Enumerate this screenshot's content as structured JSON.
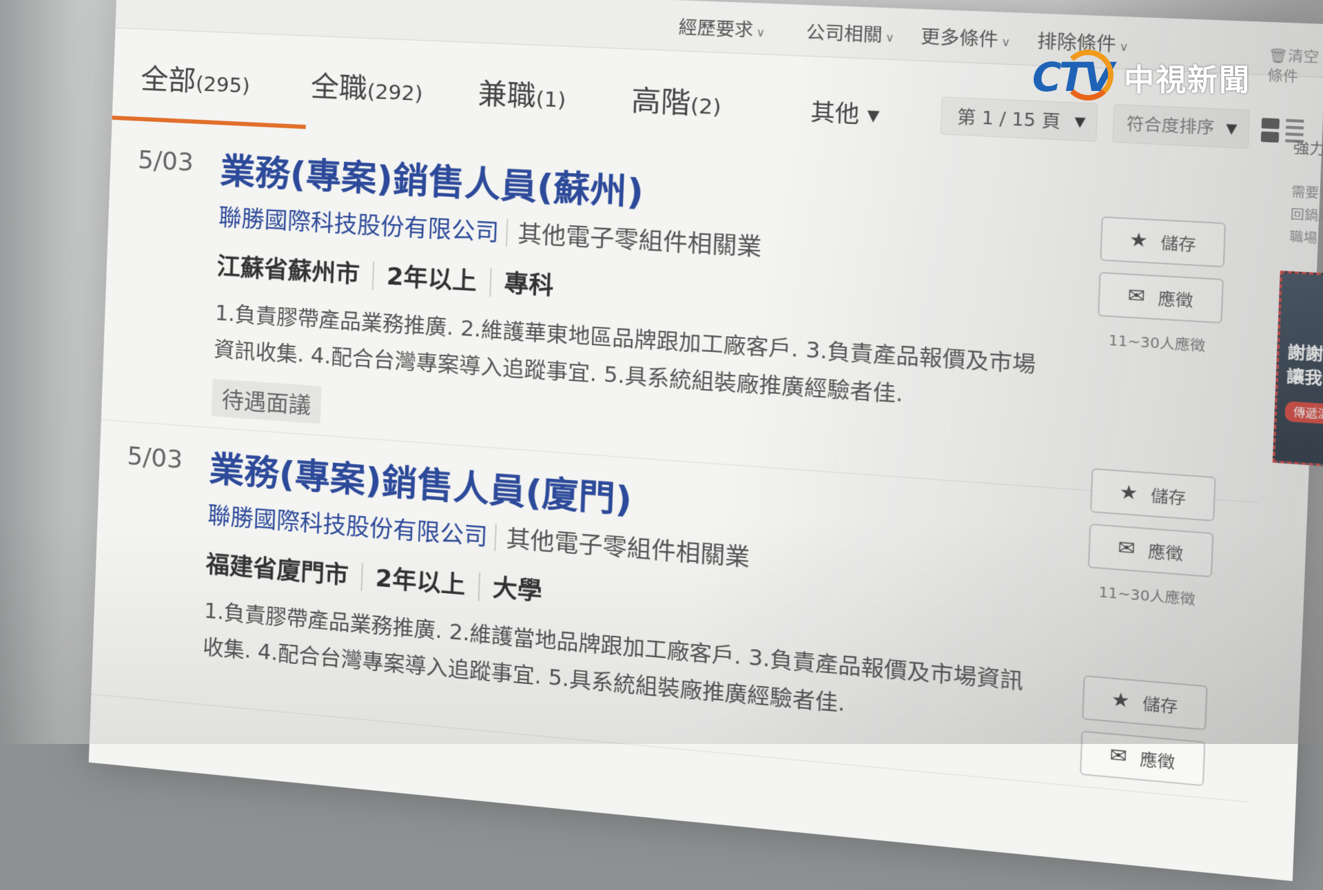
{
  "filters": [
    {
      "label": "經歷要求"
    },
    {
      "label": "公司相關"
    },
    {
      "label": "更多條件"
    },
    {
      "label": "排除條件"
    }
  ],
  "clear_filter": "清空條件",
  "tabs": [
    {
      "label": "全部",
      "count": "(295)"
    },
    {
      "label": "全職",
      "count": "(292)"
    },
    {
      "label": "兼職",
      "count": "(1)"
    },
    {
      "label": "高階",
      "count": "(2)"
    }
  ],
  "other_tab": "其他",
  "pager": "第 1 / 15 頁",
  "sort": "符合度排序",
  "jobs": [
    {
      "date": "5/03",
      "title": "業務(專案)銷售人員(蘇州)",
      "company": "聯勝國際科技股份有限公司",
      "industry": "其他電子零組件相關業",
      "location": "江蘇省蘇州市",
      "experience": "2年以上",
      "education": "專科",
      "description": "1.負責膠帶產品業務推廣. 2.維護華東地區品牌跟加工廠客戶. 3.負責產品報價及市場資訊收集. 4.配合台灣專案導入追蹤事宜. 5.具系統組裝廠推廣經驗者佳.",
      "salary": "待遇面議",
      "save_label": "儲存",
      "apply_label": "應徵",
      "applicants": "11~30人應徵"
    },
    {
      "date": "5/03",
      "title": "業務(專案)銷售人員(廈門)",
      "company": "聯勝國際科技股份有限公司",
      "industry": "其他電子零組件相關業",
      "location": "福建省廈門市",
      "experience": "2年以上",
      "education": "大學",
      "description": "1.負責膠帶產品業務推廣. 2.維護當地品牌跟加工廠客戶. 3.負責產品報價及市場資訊收集. 4.配合台灣專案導入追蹤事宜. 5.具系統組裝廠推廣經驗者佳.",
      "save_label": "儲存",
      "apply_label": "應徵",
      "applicants": "11~30人應徵"
    }
  ],
  "third_job": {
    "save_label": "儲存",
    "apply_label": "應徵"
  },
  "sidebar": {
    "title": "強力放送",
    "text": "需要留停後，回鍋順利回到職場",
    "ad_text": "謝謝幫我看見 讓我有信心",
    "ad_button": "傳遞溫暖 ›"
  },
  "logo": {
    "mark": "CTV",
    "name": "中視新聞"
  },
  "colors": {
    "tab_accent": "#e06f2a",
    "title_blue": "#2d4a9a",
    "logo_blue": "#1e63b6",
    "logo_orange": "#f29a1e"
  }
}
